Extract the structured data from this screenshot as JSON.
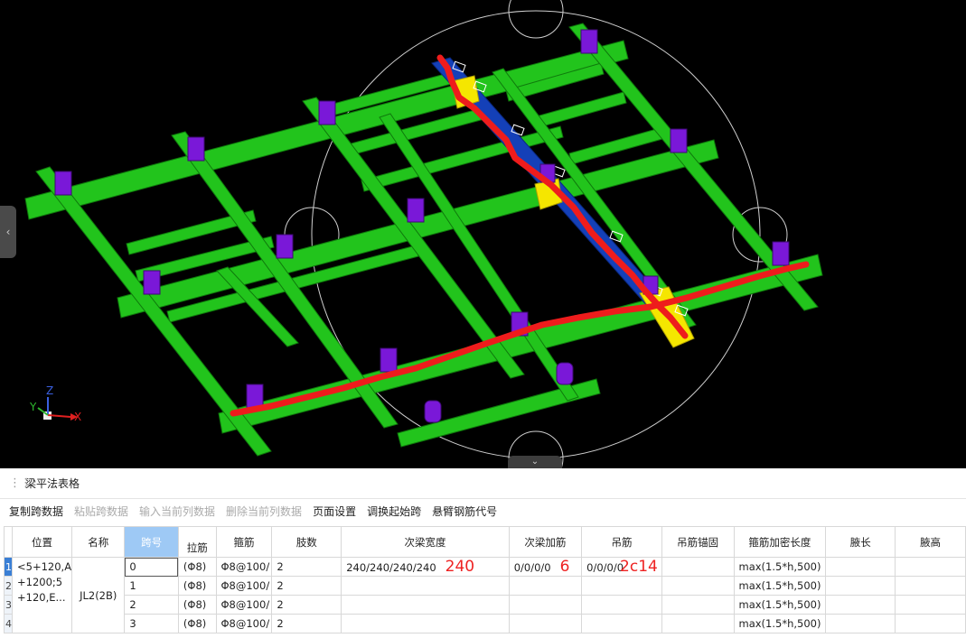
{
  "viewport": {
    "axes": {
      "x": "X",
      "y": "Y",
      "z": "Z"
    }
  },
  "panel": {
    "title": "梁平法表格",
    "toolbar": {
      "copy_span": "复制跨数据",
      "paste_span": "粘贴跨数据",
      "input_column": "输入当前列数据",
      "delete_column": "删除当前列数据",
      "page_setup": "页面设置",
      "adjust_start": "调换起始跨",
      "cantilever_code": "悬臂钢筋代号"
    }
  },
  "table": {
    "headers": {
      "position": "位置",
      "name": "名称",
      "span": "跨号",
      "tie": "拉筋",
      "stirrup": "箍筋",
      "legs": "肢数",
      "sec_width": "次梁宽度",
      "sec_add": "次梁加筋",
      "hanger": "吊筋",
      "hanger_anchor": "吊筋锚固",
      "dense_len": "箍筋加密长度",
      "haunch_len": "腋长",
      "haunch_h": "腋高"
    },
    "row_numbers": [
      "1",
      "2",
      "3",
      "4"
    ],
    "position_text": "<5+120,A +1200;5 +120,E...",
    "name_text": "JL2(2B)",
    "rows": [
      {
        "span": "0",
        "tie": "(Φ8)",
        "stirrup": "Φ8@100/",
        "legs": "2",
        "sec_width": "240/240/240/240",
        "sec_add": "0/0/0/0",
        "hanger": "0/0/0/0",
        "dense_len": "max(1.5*h,500)"
      },
      {
        "span": "1",
        "tie": "(Φ8)",
        "stirrup": "Φ8@100/",
        "legs": "2",
        "sec_width": "",
        "sec_add": "",
        "hanger": "",
        "dense_len": "max(1.5*h,500)"
      },
      {
        "span": "2",
        "tie": "(Φ8)",
        "stirrup": "Φ8@100/",
        "legs": "2",
        "sec_width": "",
        "sec_add": "",
        "hanger": "",
        "dense_len": "max(1.5*h,500)"
      },
      {
        "span": "3",
        "tie": "(Φ8)",
        "stirrup": "Φ8@100/",
        "legs": "2",
        "sec_width": "",
        "sec_add": "",
        "hanger": "",
        "dense_len": "max(1.5*h,500)"
      }
    ],
    "annotations": {
      "sec_width": "240",
      "sec_add": "6",
      "hanger": "2c14"
    }
  },
  "colors": {
    "beam": "#22c41c",
    "column": "#7a18d8",
    "selected_beam": "#1440b8",
    "highlight": "#f5e600",
    "markup": "#ee1c1c",
    "header_selected": "#9ec9f5"
  }
}
